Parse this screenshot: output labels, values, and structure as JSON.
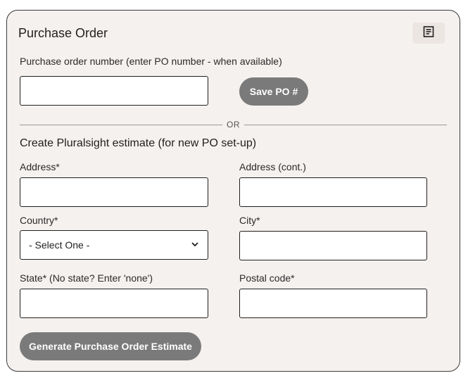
{
  "card": {
    "title": "Purchase Order",
    "receipt_icon": "receipt-icon"
  },
  "po": {
    "label": "Purchase order number (enter PO number - when available)",
    "value": "",
    "save_label": "Save PO #"
  },
  "divider": {
    "text": "OR"
  },
  "estimate": {
    "heading": "Create Pluralsight estimate (for new PO set-up)",
    "address_label": "Address*",
    "address_value": "",
    "address_cont_label": "Address (cont.)",
    "address_cont_value": "",
    "country_label": "Country*",
    "country_selected": "- Select One -",
    "city_label": "City*",
    "city_value": "",
    "state_label": "State* (No state? Enter 'none')",
    "state_value": "",
    "postal_label": "Postal code*",
    "postal_value": "",
    "generate_label": "Generate Purchase Order Estimate"
  },
  "colors": {
    "card_bg": "#f5f1ef",
    "button_bg": "#7a7a7a"
  }
}
